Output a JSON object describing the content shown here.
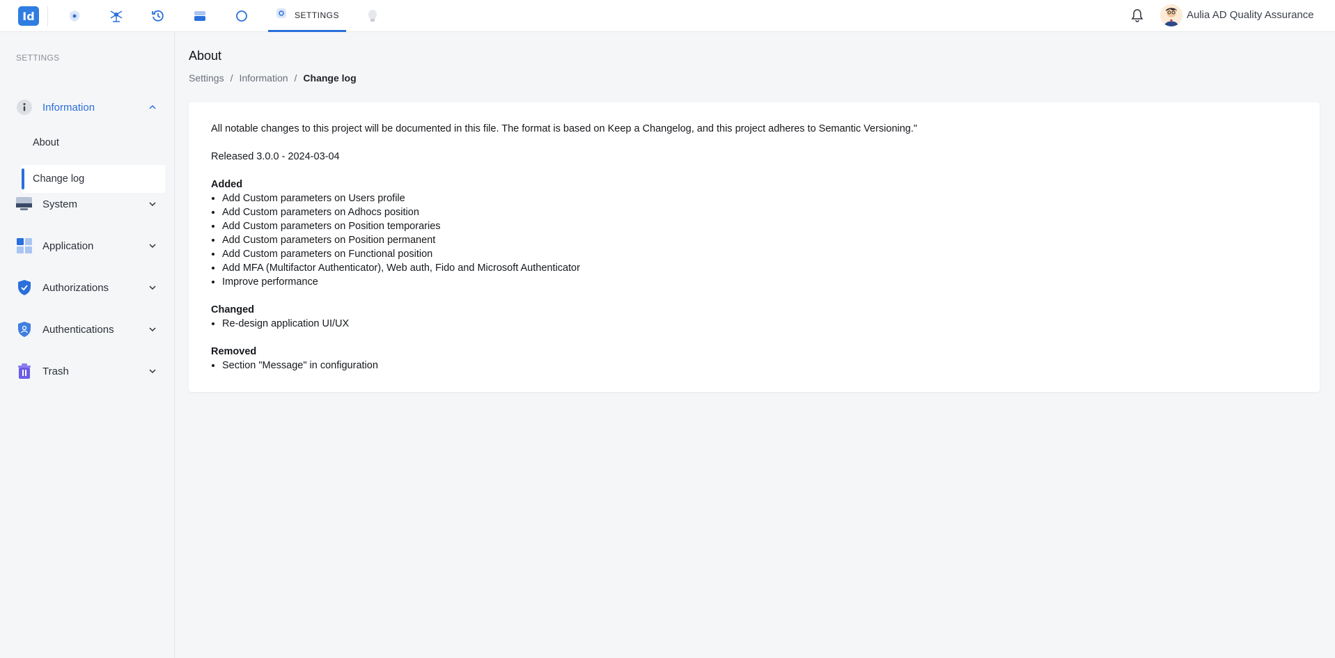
{
  "topbar": {
    "logo_text": "Id",
    "nav_icons": [
      "shield-badge-icon",
      "network-hub-icon",
      "history-icon",
      "storage-icon",
      "circle-icon",
      "settings-icon",
      "bulb-icon"
    ],
    "active_tab_label": "SETTINGS",
    "user_name": "Aulia AD Quality Assurance",
    "accent_color": "#2a6fdb"
  },
  "sidebar": {
    "title": "SETTINGS",
    "items": [
      {
        "label": "Information",
        "icon": "info-icon",
        "expanded": true
      },
      {
        "label": "System",
        "icon": "monitor-icon",
        "expanded": false
      },
      {
        "label": "Application",
        "icon": "apps-grid-icon",
        "expanded": false
      },
      {
        "label": "Authorizations",
        "icon": "shield-check-icon",
        "expanded": false
      },
      {
        "label": "Authentications",
        "icon": "shield-user-icon",
        "expanded": false
      },
      {
        "label": "Trash",
        "icon": "trash-icon",
        "expanded": false
      }
    ],
    "sub_items": [
      {
        "label": "About",
        "selected": false
      },
      {
        "label": "Change log",
        "selected": true
      }
    ]
  },
  "main": {
    "title": "About",
    "breadcrumb": [
      "Settings",
      "/",
      "Information",
      "/",
      "Change log"
    ],
    "changelog": {
      "intro": "All notable changes to this project will be documented in this file. The format is based on Keep a Changelog, and this project adheres to Semantic Versioning.\"",
      "release": "Released 3.0.0 - 2024-03-04",
      "added_heading": "Added",
      "added": [
        "Add Custom parameters on Users profile",
        "Add Custom parameters on Adhocs position",
        "Add Custom parameters on Position temporaries",
        "Add Custom parameters on Position permanent",
        "Add Custom parameters on Functional position",
        "Add MFA (Multifactor Authenticator), Web auth, Fido and Microsoft Authenticator",
        "Improve performance"
      ],
      "changed_heading": "Changed",
      "changed": [
        "Re-design application UI/UX"
      ],
      "removed_heading": "Removed",
      "removed": [
        "Section \"Message\" in configuration"
      ]
    }
  }
}
